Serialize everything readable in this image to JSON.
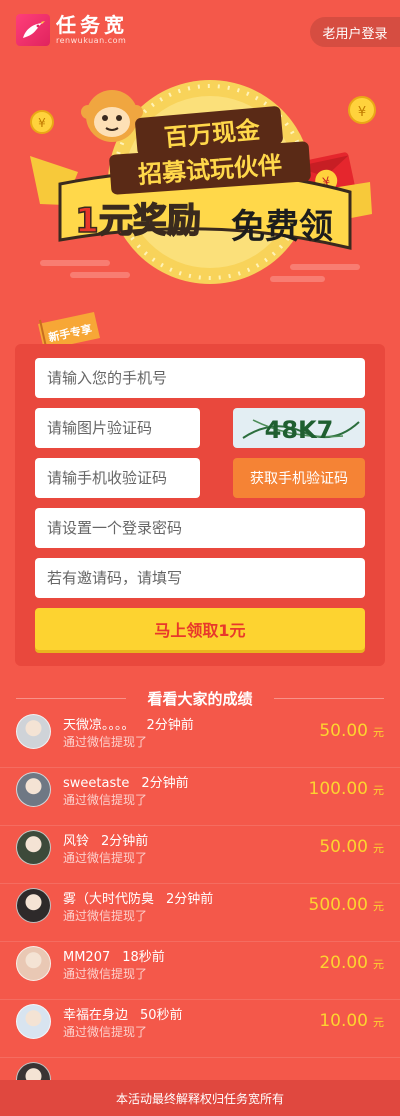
{
  "header": {
    "logo_cn": "任务宽",
    "logo_en": "renwukuan.com",
    "old_user_login": "老用户登录"
  },
  "banner": {
    "line1": "百万现金",
    "line2": "招募试玩伙伴",
    "line3_a": "1元奖励",
    "line3_b": "免费领",
    "coin_symbol": "¥"
  },
  "form": {
    "flag_label": "新手专享",
    "phone_placeholder": "请输入您的手机号",
    "img_code_placeholder": "请输图片验证码",
    "captcha_text": "48K7",
    "sms_code_placeholder": "请输手机收验证码",
    "get_sms_button": "获取手机验证码",
    "password_placeholder": "请设置一个登录密码",
    "invite_placeholder": "若有邀请码，请填写",
    "submit_button": "马上领取1元"
  },
  "results": {
    "title": "看看大家的成绩",
    "items": [
      {
        "name": "天微凉。。。。",
        "time": "2分钟前",
        "desc": "通过微信提现了",
        "amount": "50.00",
        "unit": "元",
        "avatar_color": "#cfd3d8"
      },
      {
        "name": "sweetaste",
        "time": "2分钟前",
        "desc": "通过微信提现了",
        "amount": "100.00",
        "unit": "元",
        "avatar_color": "#6f7884"
      },
      {
        "name": "风铃",
        "time": "2分钟前",
        "desc": "通过微信提现了",
        "amount": "50.00",
        "unit": "元",
        "avatar_color": "#3d4a3a"
      },
      {
        "name": "雾（大时代防臭",
        "time": "2分钟前",
        "desc": "通过微信提现了",
        "amount": "500.00",
        "unit": "元",
        "avatar_color": "#2e2a2a"
      },
      {
        "name": "MM207",
        "time": "18秒前",
        "desc": "通过微信提现了",
        "amount": "20.00",
        "unit": "元",
        "avatar_color": "#e9c8b4"
      },
      {
        "name": "幸福在身边",
        "time": "50秒前",
        "desc": "通过微信提现了",
        "amount": "10.00",
        "unit": "元",
        "avatar_color": "#d8e4f0"
      },
      {
        "name": "",
        "time": "",
        "desc": "",
        "amount": "",
        "unit": "",
        "avatar_color": "#3a3434"
      }
    ]
  },
  "footer": {
    "text": "本活动最终解释权归任务宽所有"
  },
  "colors": {
    "background": "#f4584a",
    "panel": "#e9483d",
    "orange_button": "#f58335",
    "yellow_button": "#fdd330",
    "amount": "#fdd330"
  }
}
